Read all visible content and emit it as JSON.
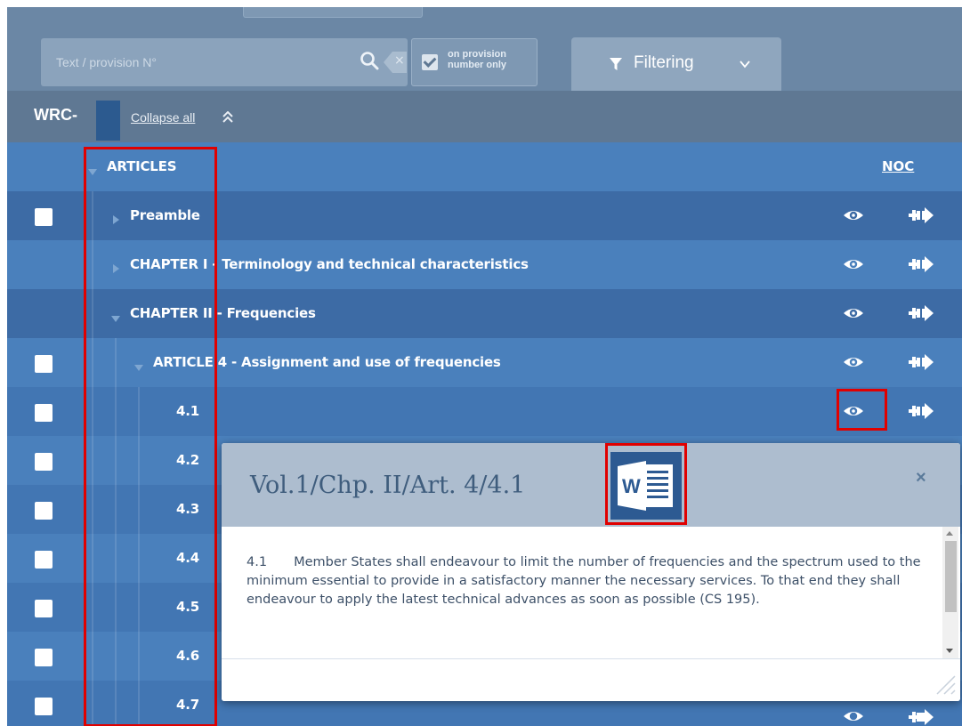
{
  "search": {
    "placeholder": "Text / provision N°",
    "clear_label": "×",
    "option_label_line1": "on provision",
    "option_label_line2": "number only",
    "option_checked": true,
    "filter_label": "Filtering"
  },
  "header": {
    "title": "WRC-",
    "collapse_label": "Collapse all"
  },
  "tree": {
    "noc_label": "NOC",
    "root_label": "ARTICLES",
    "rows": [
      {
        "label": "Preamble"
      },
      {
        "label": "CHAPTER I - Terminology and technical characteristics"
      },
      {
        "label": "CHAPTER II - Frequencies"
      },
      {
        "label": "ARTICLE 4 - Assignment and use of frequencies"
      },
      {
        "label": "4.1"
      },
      {
        "label": "4.2"
      },
      {
        "label": "4.3"
      },
      {
        "label": "4.4"
      },
      {
        "label": "4.5"
      },
      {
        "label": "4.6"
      },
      {
        "label": "4.7"
      }
    ]
  },
  "popup": {
    "title": "Vol.1/Chp. II/Art. 4/4.1",
    "close_label": "×",
    "word_letter": "W",
    "provision_number": "4.1",
    "provision_text": "Member States shall endeavour to limit the number of frequencies and the spectrum used to the minimum essential to provide in a satisfactory manner the necessary services. To that end they shall endeavour to apply the latest technical advances as soon as possible (CS 195)."
  },
  "colors": {
    "header_bg": "#6b87a5",
    "tree_row": "#4b7fba",
    "tree_row_alt": "#3d6ba5",
    "highlight": "#e00000",
    "word_blue": "#2d5a92"
  }
}
